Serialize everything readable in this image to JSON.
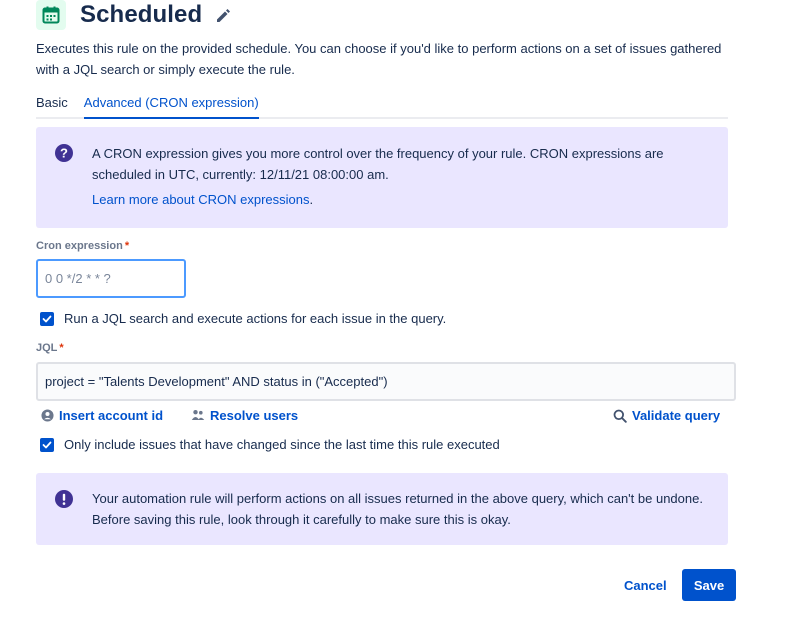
{
  "header": {
    "title": "Scheduled",
    "icon": "calendar-icon",
    "edit_icon": "pencil-icon"
  },
  "description": "Executes this rule on the provided schedule. You can choose if you'd like to perform actions on a set of issues gathered with a JQL search or simply execute the rule.",
  "tabs": [
    {
      "label": "Basic",
      "active": false
    },
    {
      "label": "Advanced (CRON expression)",
      "active": true
    }
  ],
  "info_panel": {
    "text": "A CRON expression gives you more control over the frequency of your rule. CRON expressions are scheduled in UTC, currently: 12/11/21 08:00:00 am.",
    "link": "Learn more about CRON expressions",
    "link_suffix": "."
  },
  "cron": {
    "label": "Cron expression",
    "required_mark": "*",
    "value": "",
    "placeholder": "0 0 */2 * * ?"
  },
  "jql_checkbox": {
    "label": "Run a JQL search and execute actions for each issue in the query.",
    "checked": true
  },
  "jql": {
    "label": "JQL",
    "required_mark": "*",
    "value": "project = \"Talents Development\" AND status in (\"Accepted\")"
  },
  "actions": {
    "insert_account_id": "Insert account id",
    "resolve_users": "Resolve users",
    "validate_query": "Validate query"
  },
  "changed_checkbox": {
    "label": "Only include issues that have changed since the last time this rule executed",
    "checked": true
  },
  "warning_panel": {
    "text": "Your automation rule will perform actions on all issues returned in the above query, which can't be undone. Before saving this rule, look through it carefully to make sure this is okay."
  },
  "footer": {
    "cancel_label": "Cancel",
    "save_label": "Save"
  },
  "colors": {
    "primary": "#0052cc",
    "panel_bg": "#eae6ff",
    "discovery": "#403294",
    "calendar_green": "#00875a"
  }
}
